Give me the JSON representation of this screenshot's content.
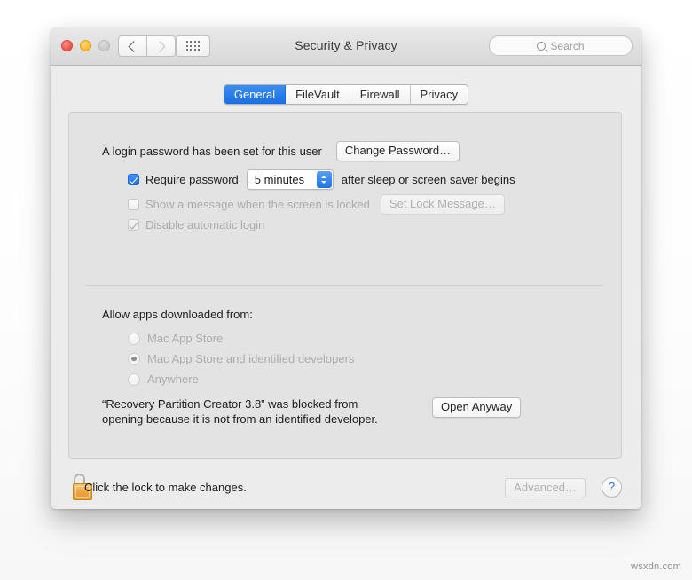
{
  "window": {
    "title": "Security & Privacy",
    "traffic_lights": [
      "close",
      "minimize",
      "zoom"
    ],
    "nav_back": "back-arrow",
    "nav_forward": "forward-arrow",
    "grid_button": "show-all-grid",
    "search": {
      "placeholder": "Search",
      "value": "",
      "icon": "search-icon"
    }
  },
  "tabs": [
    {
      "label": "General",
      "selected": true
    },
    {
      "label": "FileVault",
      "selected": false
    },
    {
      "label": "Firewall",
      "selected": false
    },
    {
      "label": "Privacy",
      "selected": false
    }
  ],
  "general": {
    "login_password_text": "A login password has been set for this user",
    "change_password_button": "Change Password…",
    "require_password": {
      "checked": true,
      "enabled": true,
      "label": "Require password",
      "interval_value": "5 minutes",
      "suffix": "after sleep or screen saver begins"
    },
    "show_message": {
      "checked": false,
      "enabled": false,
      "label": "Show a message when the screen is locked",
      "button": "Set Lock Message…",
      "button_enabled": false
    },
    "disable_auto_login": {
      "checked": true,
      "enabled": false,
      "label": "Disable automatic login"
    },
    "allow_apps_heading": "Allow apps downloaded from:",
    "allow_apps_options": [
      {
        "label": "Mac App Store",
        "selected": false,
        "enabled": false
      },
      {
        "label": "Mac App Store and identified developers",
        "selected": true,
        "enabled": false
      },
      {
        "label": "Anywhere",
        "selected": false,
        "enabled": false
      }
    ],
    "blocked_message_line1": "“Recovery Partition Creator 3.8” was blocked from",
    "blocked_message_line2": "opening because it is not from an identified developer.",
    "open_anyway_button": "Open Anyway"
  },
  "bottom_bar": {
    "lock_icon": "padlock-unlocked-icon",
    "lock_text": "Click the lock to make changes.",
    "advanced_button": "Advanced…",
    "advanced_enabled": false,
    "help_button": "?"
  },
  "watermark": "wsxdn.com",
  "colors": {
    "accent_blue": "#1f73e8",
    "tab_selected": "#2a7ee9",
    "window_chrome": "#e3e3e3",
    "panel_bg": "#e3e3e3",
    "lock_gold": "#eaa440",
    "help_blue": "#2a6fd6"
  }
}
